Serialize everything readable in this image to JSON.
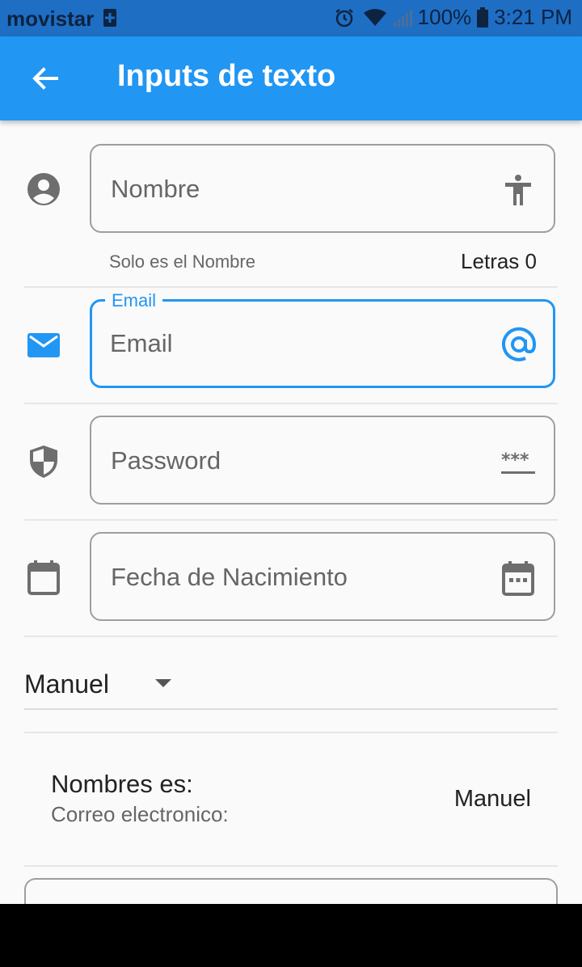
{
  "status_bar": {
    "carrier": "movistar",
    "battery": "100%",
    "time": "3:21 PM"
  },
  "appbar": {
    "title": "Inputs de texto"
  },
  "form": {
    "nombre": {
      "placeholder": "Nombre",
      "helper": "Solo es el Nombre",
      "counter": "Letras 0"
    },
    "email": {
      "label": "Email",
      "placeholder": "Email"
    },
    "password": {
      "placeholder": "Password"
    },
    "fecha": {
      "placeholder": "Fecha de Nacimiento"
    },
    "dropdown": {
      "selected": "Manuel"
    }
  },
  "summary": {
    "title": "Nombres es:",
    "subtitle": "Correo electronico:",
    "value": "Manuel"
  },
  "colors": {
    "primary": "#2196f3",
    "status_bar": "#1e6ec4",
    "icon_grey": "#6e6e6e"
  }
}
